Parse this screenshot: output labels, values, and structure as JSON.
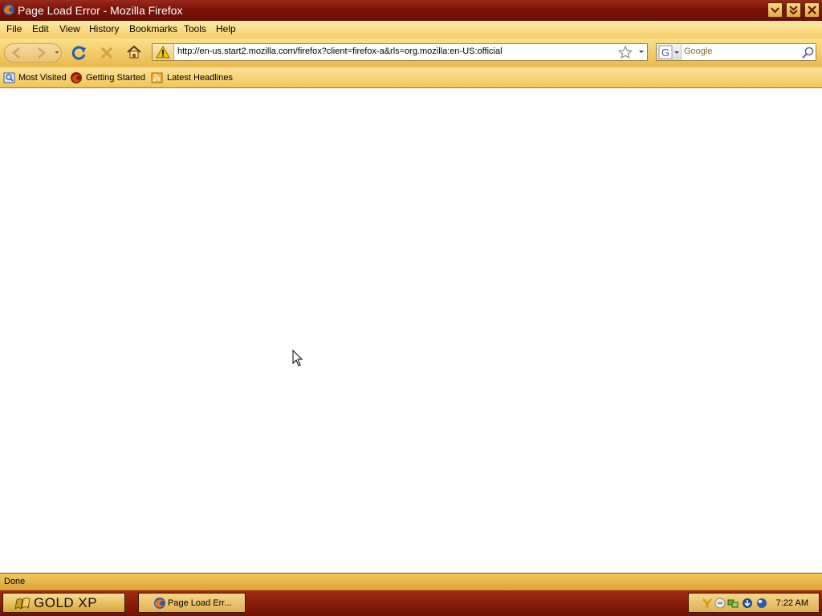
{
  "window": {
    "title": "Page Load Error - Mozilla Firefox"
  },
  "menu": {
    "items": [
      {
        "label": "File"
      },
      {
        "label": "Edit"
      },
      {
        "label": "View"
      },
      {
        "label": "History"
      },
      {
        "label": "Bookmarks"
      },
      {
        "label": "Tools"
      },
      {
        "label": "Help"
      }
    ]
  },
  "toolbar": {
    "url": "http://en-us.start2.mozilla.com/firefox?client=firefox-a&rls=org.mozilla:en-US:official",
    "search_placeholder": "Google",
    "icons": [
      "back-icon",
      "forward-icon",
      "reload-icon",
      "stop-icon",
      "home-icon",
      "warning-icon",
      "star-icon",
      "google-icon",
      "magnifier-icon"
    ]
  },
  "bookmarks": {
    "items": [
      {
        "label": "Most Visited",
        "icon": "most-visited-icon"
      },
      {
        "label": "Getting Started",
        "icon": "firefox-icon"
      },
      {
        "label": "Latest Headlines",
        "icon": "rss-icon"
      }
    ]
  },
  "status": {
    "text": "Done"
  },
  "taskbar": {
    "start_label": "GOLD XP",
    "task_label": "Page Load Err...",
    "clock": "7:22 AM"
  },
  "colors": {
    "title_bar": "#7a1408",
    "toolbar_gold": "#f0c558",
    "taskbar": "#8a1c0a"
  }
}
